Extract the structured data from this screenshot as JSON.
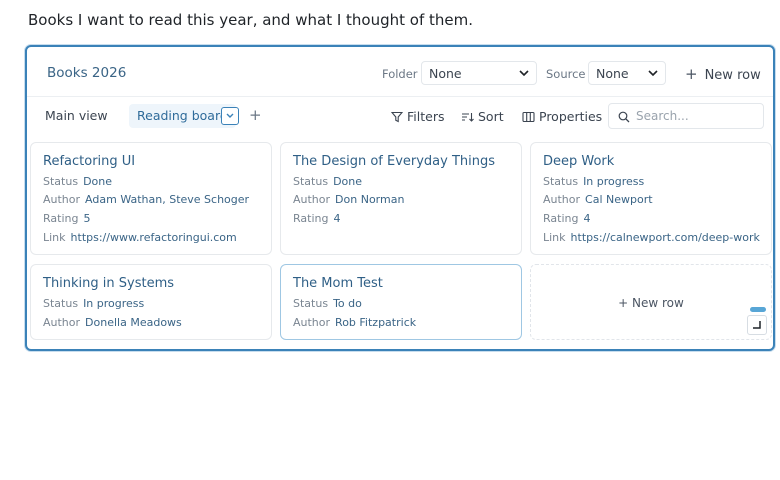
{
  "intro": "Books I want to read this year, and what I thought of them.",
  "database": {
    "title": "Books 2026",
    "folder": {
      "label": "Folder",
      "value": "None"
    },
    "source": {
      "label": "Source",
      "value": "None"
    },
    "new_row_label": "New row"
  },
  "toolbar": {
    "views": [
      {
        "label": "Main view",
        "active": false
      },
      {
        "label": "Reading board",
        "active": true
      }
    ],
    "add_view": "+",
    "filters": "Filters",
    "sort": "Sort",
    "properties": "Properties",
    "search_placeholder": "Search..."
  },
  "cards": [
    {
      "title": "Refactoring UI",
      "props": [
        {
          "key": "Status",
          "value": "Done"
        },
        {
          "key": "Author",
          "value": "Adam Wathan, Steve Schoger"
        },
        {
          "key": "Rating",
          "value": "5"
        },
        {
          "key": "Link",
          "value": "https://www.refactoringui.com"
        }
      ]
    },
    {
      "title": "The Design of Everyday Things",
      "props": [
        {
          "key": "Status",
          "value": "Done"
        },
        {
          "key": "Author",
          "value": "Don Norman"
        },
        {
          "key": "Rating",
          "value": "4"
        }
      ]
    },
    {
      "title": "Deep Work",
      "props": [
        {
          "key": "Status",
          "value": "In progress"
        },
        {
          "key": "Author",
          "value": "Cal Newport"
        },
        {
          "key": "Rating",
          "value": "4"
        },
        {
          "key": "Link",
          "value": "https://calnewport.com/deep-work"
        }
      ]
    },
    {
      "title": "Thinking in Systems",
      "props": [
        {
          "key": "Status",
          "value": "In progress"
        },
        {
          "key": "Author",
          "value": "Donella Meadows"
        }
      ]
    },
    {
      "title": "The Mom Test",
      "props": [
        {
          "key": "Status",
          "value": "To do"
        },
        {
          "key": "Author",
          "value": "Rob Fitzpatrick"
        }
      ]
    }
  ],
  "new_row_card": "+ New row",
  "colors": {
    "accent": "#3b82b8",
    "title_blue": "#2f5f86",
    "value_blue": "#3a6486"
  }
}
